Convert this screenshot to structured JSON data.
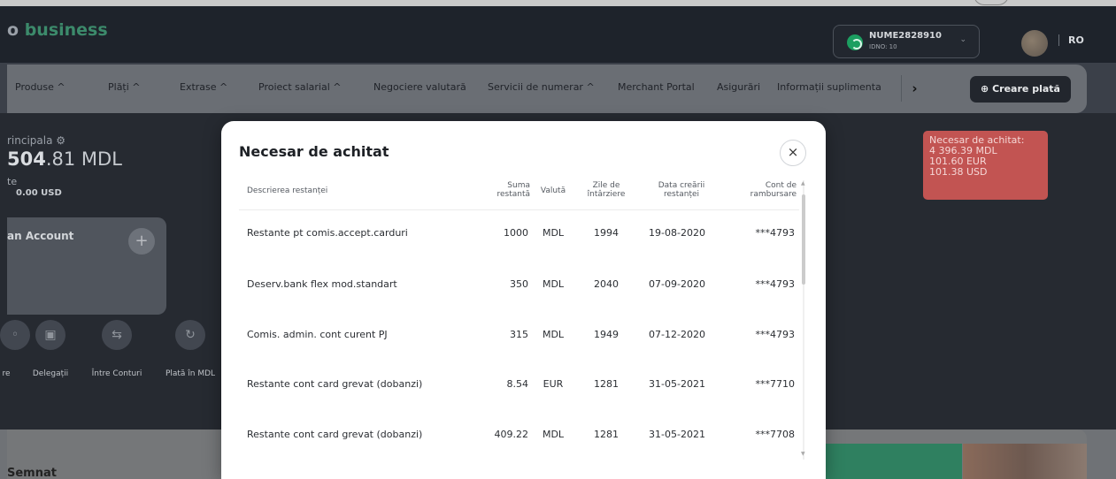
{
  "header": {
    "logo_prefix": "o",
    "logo_text": "business",
    "account": {
      "name": "NUME2828910",
      "idno": "IDNO: 10"
    },
    "language": "RO"
  },
  "nav": {
    "items": [
      "Produse ^",
      "Plăți ^",
      "Extrase ^",
      "Proiect salarial ^",
      "Negociere valutară",
      "Servicii de numerar ^",
      "Merchant Portal",
      "Asigurări",
      "Informații suplimenta"
    ],
    "more": "›",
    "create_payment": "Creare plată"
  },
  "account_panel": {
    "title": "rincipala",
    "balance_main": "504",
    "balance_rest": ".81 MDL",
    "sub_label": "te",
    "sub_value": "0.00 USD",
    "card_title": "an Account",
    "card_add": "+"
  },
  "quick_actions": [
    {
      "label": "re",
      "icon": "partial-icon"
    },
    {
      "label": "Delegații",
      "icon": "delegation-icon"
    },
    {
      "label": "Între Conturi",
      "icon": "transfer-icon"
    },
    {
      "label": "Plată în MDL",
      "icon": "payment-icon"
    }
  ],
  "alert": {
    "title": "Necesar de achitat:",
    "lines": [
      "4 396.39 MDL",
      "101.60 EUR",
      "101.38 USD"
    ]
  },
  "lower": {
    "semnat": "Semnat"
  },
  "modal": {
    "title": "Necesar de achitat",
    "close": "×",
    "columns": {
      "description": "Descrierea restanței",
      "amount": "Suma restantă",
      "currency": "Valută",
      "delay_days": "Zile de întârziere",
      "created_date": "Data creării restanței",
      "refund_account": "Cont de rambursare"
    },
    "rows": [
      {
        "description": "Restante pt comis.accept.carduri",
        "amount": "1000",
        "currency": "MDL",
        "delay_days": "1994",
        "created_date": "19-08-2020",
        "refund_account": "***4793"
      },
      {
        "description": "Deserv.bank flex mod.standart",
        "amount": "350",
        "currency": "MDL",
        "delay_days": "2040",
        "created_date": "07-09-2020",
        "refund_account": "***4793"
      },
      {
        "description": "Comis. admin. cont curent PJ",
        "amount": "315",
        "currency": "MDL",
        "delay_days": "1949",
        "created_date": "07-12-2020",
        "refund_account": "***4793"
      },
      {
        "description": "Restante cont card grevat (dobanzi)",
        "amount": "8.54",
        "currency": "EUR",
        "delay_days": "1281",
        "created_date": "31-05-2021",
        "refund_account": "***7710"
      },
      {
        "description": "Restante cont card grevat (dobanzi)",
        "amount": "409.22",
        "currency": "MDL",
        "delay_days": "1281",
        "created_date": "31-05-2021",
        "refund_account": "***7708"
      }
    ]
  }
}
